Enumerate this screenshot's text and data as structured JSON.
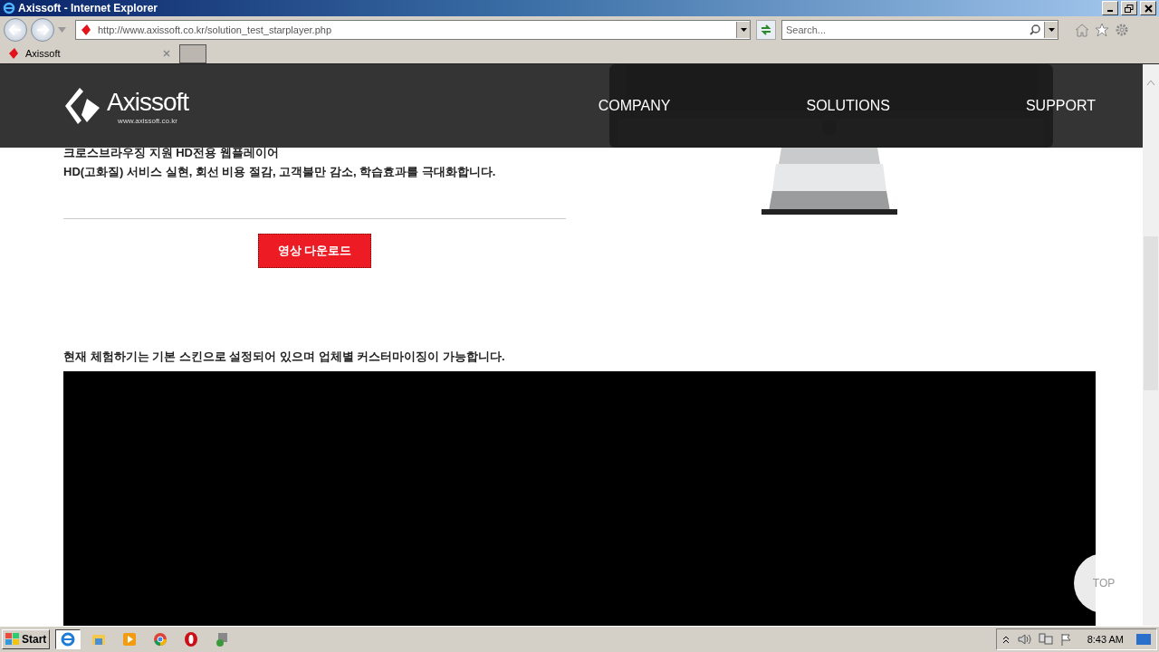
{
  "window": {
    "title": "Axissoft - Internet Explorer"
  },
  "address_bar": {
    "url": "http://www.axissoft.co.kr/solution_test_starplayer.php"
  },
  "search": {
    "placeholder": "Search..."
  },
  "tabs": [
    {
      "label": "Axissoft",
      "selected": true
    }
  ],
  "site_header": {
    "logo": "Axissoft",
    "logo_url": "www.axissoft.co.kr",
    "nav": [
      "COMPANY",
      "SOLUTIONS",
      "SUPPORT"
    ]
  },
  "intro": {
    "subtitle": "크로스브라우징 지원 HD전용 웹플레이어",
    "description": "HD(고화질) 서비스 실현, 회선 비용 절감, 고객불만 감소, 학습효과를 극대화합니다."
  },
  "download_button": "영상 다운로드",
  "notice": "현재 체험하기는 기본 스킨으로 설정되어 있으며 업체별 커스터마이징이 가능합니다.",
  "top_button": "TOP",
  "taskbar": {
    "start": "Start",
    "clock": "8:43 AM",
    "apps": [
      {
        "kind": "ie",
        "selected": true
      },
      {
        "kind": "explorer",
        "selected": false
      },
      {
        "kind": "media",
        "selected": false
      },
      {
        "kind": "chrome",
        "selected": false
      },
      {
        "kind": "opera",
        "selected": false
      },
      {
        "kind": "tool",
        "selected": false
      }
    ]
  }
}
